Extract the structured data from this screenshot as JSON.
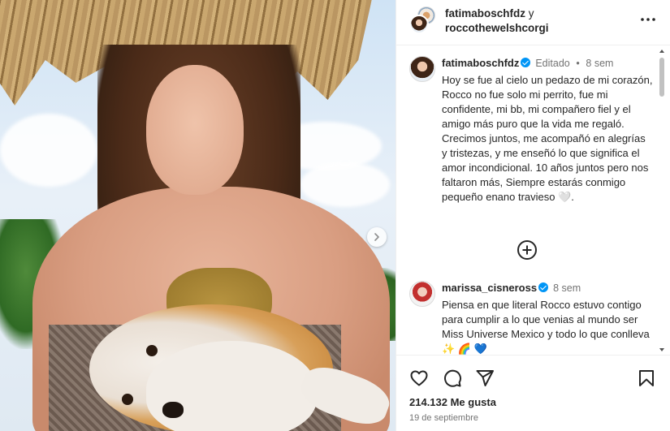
{
  "header": {
    "user1": "fatimaboschfdz",
    "conjunction": "y",
    "user2": "roccothewelshcorgi"
  },
  "caption": {
    "username": "fatimaboschfdz",
    "edited": "Editado",
    "separator": "•",
    "age": "8 sem",
    "text": "Hoy se fue al cielo un pedazo de mi corazón, Rocco no fue solo mi perrito, fue mi confidente, mi bb, mi compañero fiel y el amigo más puro que la vida me regaló. Crecimos juntos, me acompañó en alegrías y tristezas, y me enseñó lo que significa el amor incondicional. 10 años juntos pero nos faltaron más, Siempre estarás conmigo pequeño enano travieso 🤍."
  },
  "comment": {
    "username": "marissa_cisneross",
    "age": "8 sem",
    "text": "Piensa en que literal Rocco estuvo contigo para cumplir a lo que venias al mundo ser Miss Universe Mexico y todo lo que conlleva ✨ 🌈 💙"
  },
  "likes": "214.132 Me gusta",
  "date": "19 de septiembre",
  "colors": {
    "verified": "#0095f6",
    "text": "#262626",
    "secondary": "#737373",
    "divider": "#efefef"
  },
  "icons": {
    "more": "more-horizontal-icon",
    "like": "heart-icon",
    "comment": "comment-icon",
    "share": "share-icon",
    "save": "bookmark-icon",
    "load_more": "plus-circle-icon",
    "next": "chevron-right-icon"
  }
}
